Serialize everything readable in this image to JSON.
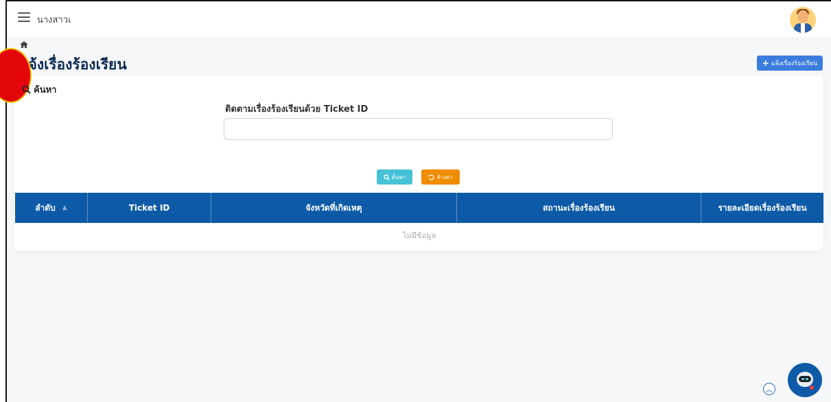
{
  "header": {
    "user_name": "นางสาวเ"
  },
  "page": {
    "title": "แจ้งเรื่องร้องเรียน",
    "add_button_label": "แจ้งเรื่องร้องเรียน"
  },
  "search": {
    "heading": "ค้นหา",
    "field_label": "ติดตามเรื่องร้องเรียนด้วย Ticket ID",
    "field_value": "",
    "field_placeholder": "",
    "search_button_label": "ค้นหา",
    "clear_button_label": "ล้างค่า"
  },
  "table": {
    "columns": [
      {
        "label": "ลำดับ",
        "sortable": true
      },
      {
        "label": "Ticket ID",
        "sortable": false
      },
      {
        "label": "จังหวัดที่เกิดเหตุ",
        "sortable": false
      },
      {
        "label": "สถานะเรื่องร้องเรียน",
        "sortable": false
      },
      {
        "label": "รายละเอียดเรื่องร้องเรียน",
        "sortable": false
      }
    ],
    "empty_text": "ไม่มีข้อมูล"
  },
  "colors": {
    "primary": "#0d5aa7",
    "accent_button": "#3b7ddd",
    "search_button": "#47c1d6",
    "clear_button": "#f08c00",
    "title": "#0d2b52"
  },
  "icons": {
    "menu": "hamburger-icon",
    "home": "home-icon",
    "search": "search-icon",
    "reset": "reset-icon",
    "plus": "plus-icon",
    "sort": "sort-icon",
    "scroll_top": "chevrons-up-icon",
    "chatbot": "chatbot-icon"
  }
}
